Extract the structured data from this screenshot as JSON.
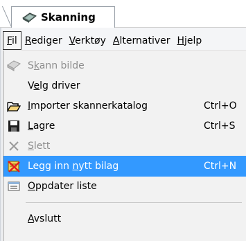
{
  "tab": {
    "label": "Skanning",
    "icon": "scanner-icon"
  },
  "menubar": {
    "items": [
      {
        "before": "",
        "accel": "F",
        "after": "il"
      },
      {
        "before": "",
        "accel": "R",
        "after": "ediger"
      },
      {
        "before": "",
        "accel": "V",
        "after": "erktøy"
      },
      {
        "before": "",
        "accel": "A",
        "after": "lternativer"
      },
      {
        "before": "",
        "accel": "H",
        "after": "jelp"
      }
    ]
  },
  "menu": {
    "items": [
      {
        "before": "S",
        "accel": "k",
        "after": "ann bilde",
        "shortcut": "",
        "disabled": true,
        "icon": "scan-image-icon"
      },
      {
        "before": "V",
        "accel": "e",
        "after": "lg driver",
        "shortcut": "",
        "disabled": false,
        "icon": ""
      },
      {
        "before": "",
        "accel": "I",
        "after": "mporter skannerkatalog",
        "shortcut": "Ctrl+O",
        "disabled": false,
        "icon": "open-folder-icon"
      },
      {
        "before": "",
        "accel": "L",
        "after": "agre",
        "shortcut": "Ctrl+S",
        "disabled": false,
        "icon": "save-icon"
      },
      {
        "before": "",
        "accel": "S",
        "after": "lett",
        "shortcut": "",
        "disabled": true,
        "icon": "delete-x-icon"
      },
      {
        "before": "Legg inn ",
        "accel": "n",
        "after": "ytt bilag",
        "shortcut": "Ctrl+N",
        "disabled": false,
        "icon": "new-voucher-icon"
      },
      {
        "before": "",
        "accel": "O",
        "after": "ppdater liste",
        "shortcut": "",
        "disabled": false,
        "icon": "refresh-list-icon"
      },
      {
        "before": "",
        "accel": "A",
        "after": "vslutt",
        "shortcut": "",
        "disabled": false,
        "icon": ""
      }
    ]
  },
  "colors": {
    "highlight": "#3399ff",
    "menu_bg": "#f2f2f2",
    "disabled_text": "#8d8d8d"
  }
}
